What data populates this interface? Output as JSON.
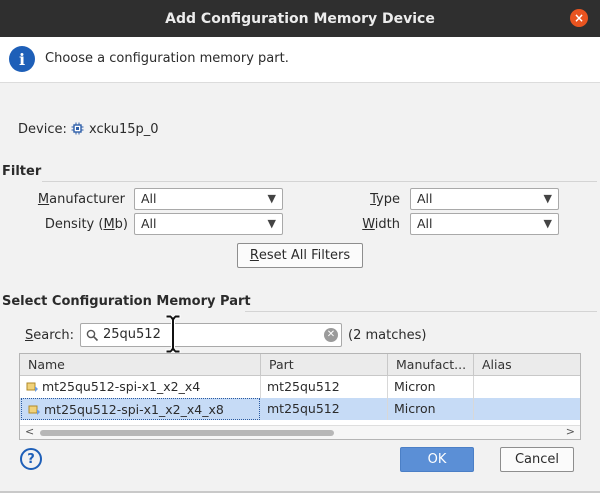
{
  "window": {
    "title": "Add Configuration Memory Device",
    "close_glyph": "×"
  },
  "banner": {
    "message": "Choose a configuration memory part."
  },
  "device": {
    "label": "Device:",
    "value": "xcku15p_0"
  },
  "filter": {
    "title": "Filter",
    "manufacturer": {
      "label_pre": "",
      "label_ul": "M",
      "label_post": "anufacturer",
      "value": "All"
    },
    "density": {
      "label_pre": "Density (",
      "label_ul": "M",
      "label_post": "b)",
      "value": "All"
    },
    "type": {
      "label_pre": "",
      "label_ul": "T",
      "label_post": "ype",
      "value": "All"
    },
    "width": {
      "label_pre": "",
      "label_ul": "W",
      "label_post": "idth",
      "value": "All"
    },
    "reset": {
      "label_ul": "R",
      "label_post": "eset All Filters"
    }
  },
  "select": {
    "title": "Select Configuration Memory Part",
    "search_label_pre": "S",
    "search_label_post": "earch:",
    "search_value": "25qu512",
    "matches": "(2 matches)"
  },
  "table": {
    "columns": [
      "Name",
      "Part",
      "Manufact...",
      "Alias"
    ],
    "rows": [
      {
        "name": "mt25qu512-spi-x1_x2_x4",
        "part": "mt25qu512",
        "manufacturer": "Micron",
        "alias": ""
      },
      {
        "name": "mt25qu512-spi-x1_x2_x4_x8",
        "part": "mt25qu512",
        "manufacturer": "Micron",
        "alias": ""
      }
    ],
    "selected_row": 1
  },
  "buttons": {
    "ok": "OK",
    "cancel": "Cancel",
    "help": "?"
  },
  "colors": {
    "accent": "#5b8fd6",
    "titlebar": "#2f2f2f",
    "close": "#e95420",
    "selection": "#c6dbf6",
    "info": "#1e5fb8"
  },
  "icons": {
    "info": "info-icon",
    "chip": "chip-icon",
    "search": "search-icon",
    "clear": "clear-icon",
    "help": "help-icon"
  }
}
